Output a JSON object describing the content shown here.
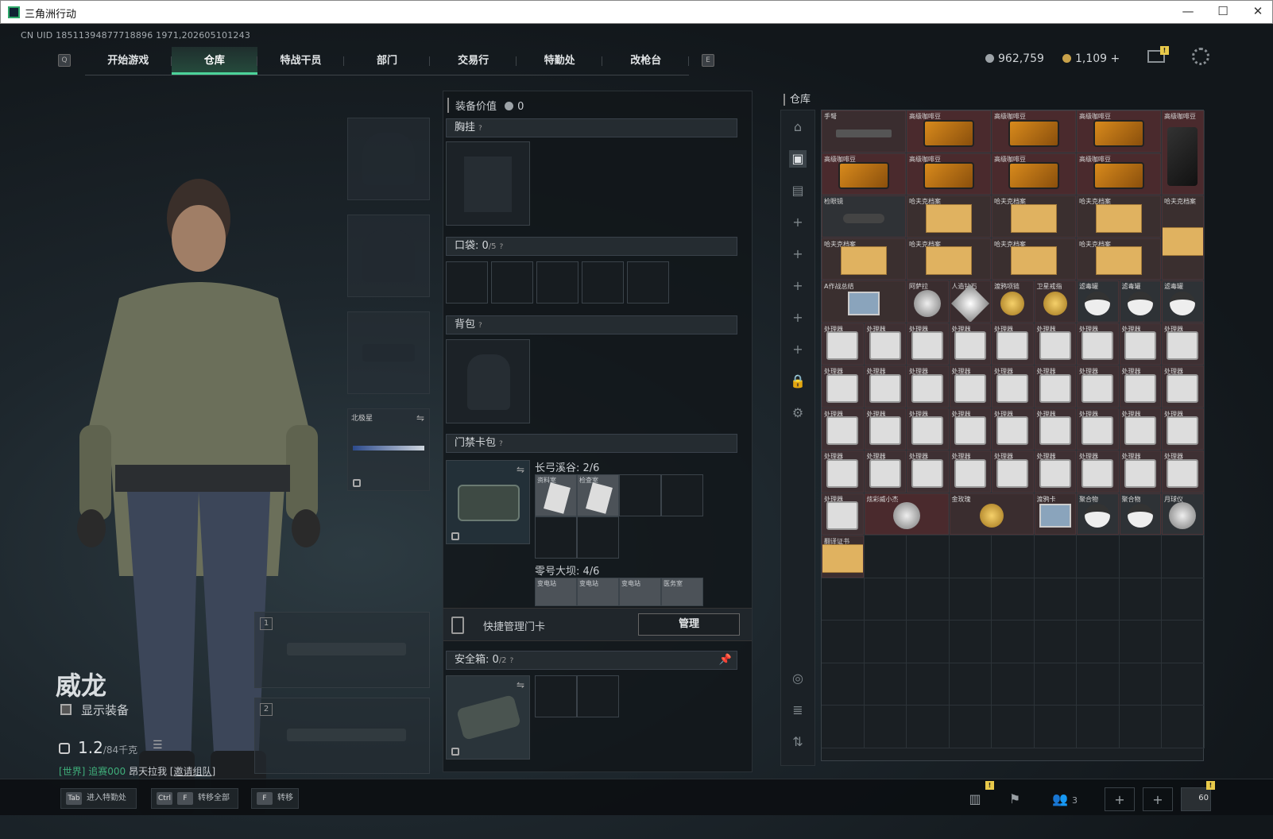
{
  "window": {
    "title": "三角洲行动",
    "min": "—",
    "max": "☐",
    "close": "✕"
  },
  "uid": "CN UID 18511394877718896 1971,202605101243",
  "keys": {
    "left": "Q",
    "right": "E"
  },
  "nav": [
    "开始游戏",
    "仓库",
    "特战干员",
    "部门",
    "交易行",
    "特勤处",
    "改枪台"
  ],
  "currency": {
    "silver": "962,759",
    "gold": "1,109",
    "plus": "+"
  },
  "character": {
    "name": "威龙",
    "show_equip": "显示装备",
    "weight": "1.2",
    "weight_max": "/84千克",
    "chat_world": "[世界]",
    "chat_user": "追赛000",
    "chat_msg": "昂天拉我",
    "chat_link": "[邀请组队]"
  },
  "loadout": {
    "melee_label": "北极星",
    "slot1": "1",
    "slot2": "2"
  },
  "equip": {
    "value_label": "装备价值",
    "value": "0",
    "chest": "胸挂",
    "pocket": "口袋:",
    "pocket_count": "0",
    "pocket_max": "/5",
    "backpack": "背包",
    "keycard": "门禁卡包",
    "map1": "长弓溪谷: 2/6",
    "map2": "零号大坝: 4/6",
    "key1a": "资料室",
    "key1b": "检查室",
    "key2a": "变电站",
    "key2b": "变电站",
    "key2c": "变电站",
    "key2d": "医务室",
    "quick": "快捷管理门卡",
    "manage": "管理",
    "safe": "安全箱:",
    "safe_count": "0",
    "safe_max": "/2"
  },
  "warehouse": {
    "title": "仓库",
    "items": {
      "crossbow": "手弩",
      "coffee": "高级咖啡豆",
      "scope": "检眼镜",
      "file": "哈夫克档案",
      "medal": "A作战总结",
      "wrench": "阿萨拉",
      "diamond": "人造钻石",
      "key_chain": "渡鸦项链",
      "ring": "卫星戒指",
      "filter": "滤毒罐",
      "proc": "处理器",
      "gold_armor": "炫彩威小杰",
      "rose": "金玫瑰",
      "card": "渡鸦卡",
      "sphere": "聚合物",
      "moon": "月球仪",
      "cert": "翻译证书"
    }
  },
  "bottom": {
    "tab": "Tab",
    "tab_label": "进入特勤处",
    "ctrl": "Ctrl",
    "f": "F",
    "transfer_all": "转移全部",
    "f2": "F",
    "transfer": "转移",
    "friends": "3",
    "level": "60",
    "badge": "!"
  }
}
